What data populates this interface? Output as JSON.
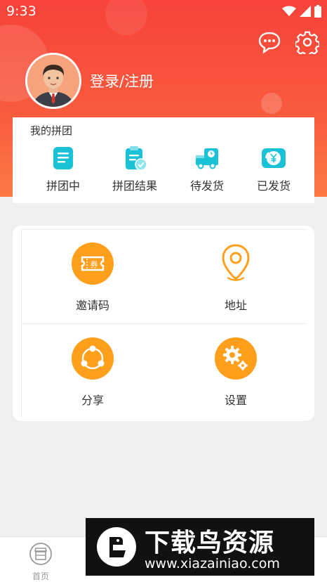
{
  "status_bar": {
    "time": "9:33"
  },
  "header": {
    "login_label": "登录/注册"
  },
  "group_buy": {
    "title": "我的拼团",
    "items": [
      {
        "label": "拼团中",
        "icon": "document-list-icon"
      },
      {
        "label": "拼团结果",
        "icon": "clipboard-check-icon"
      },
      {
        "label": "待发货",
        "icon": "delivery-truck-icon"
      },
      {
        "label": "已发货",
        "icon": "yen-refresh-icon"
      }
    ]
  },
  "menu": {
    "items": [
      {
        "label": "邀请码",
        "icon": "coupon-ticket-icon"
      },
      {
        "label": "地址",
        "icon": "location-pin-icon"
      },
      {
        "label": "分享",
        "icon": "share-icon"
      },
      {
        "label": "设置",
        "icon": "gear-icon"
      }
    ]
  },
  "bottom_nav": {
    "home_label": "首页"
  },
  "watermark": {
    "title": "下载鸟资源",
    "url": "www.xiazainiao.com"
  },
  "colors": {
    "header_red": "#f7423a",
    "header_orange": "#fb7a45",
    "accent_orange": "#ff9f1c",
    "teal": "#19c2d6"
  }
}
